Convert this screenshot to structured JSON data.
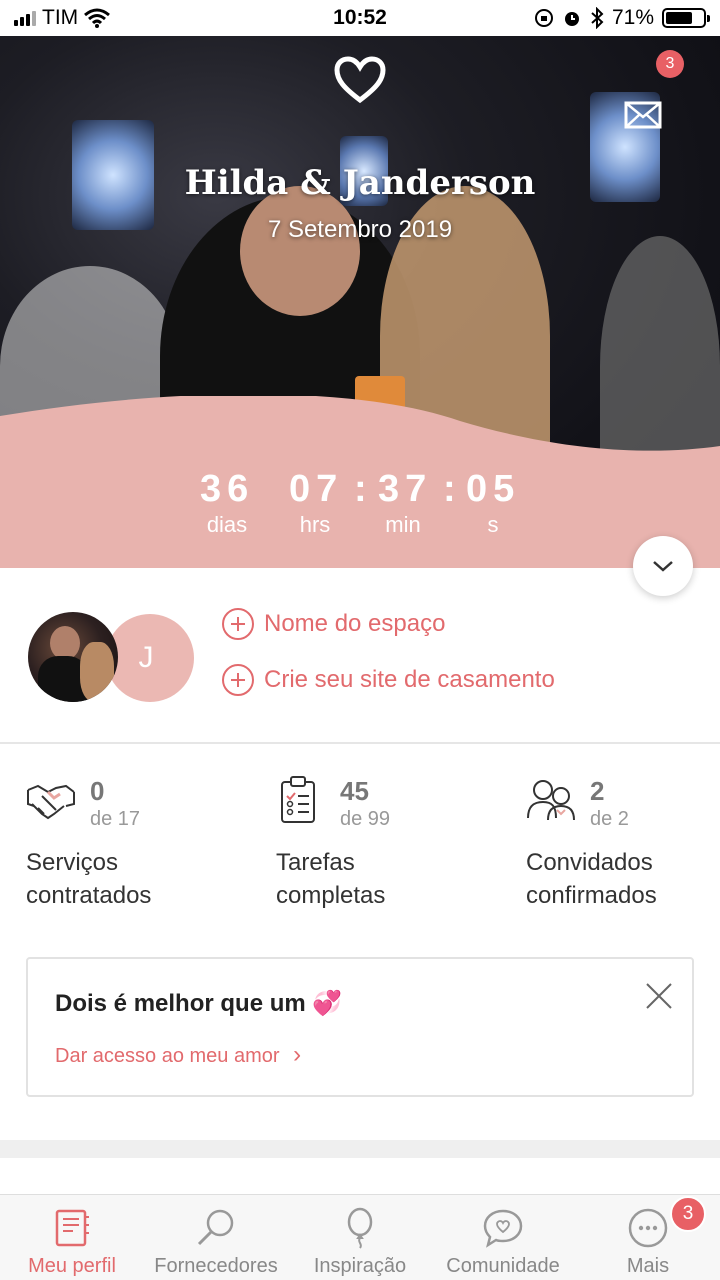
{
  "status_bar": {
    "carrier": "TIM",
    "time": "10:52",
    "battery_percent": "71%",
    "battery_level": 0.71,
    "icons": [
      "signal-icon",
      "wifi-icon",
      "rotation-lock-icon",
      "alarm-icon",
      "bluetooth-icon",
      "battery-icon"
    ]
  },
  "header": {
    "logo_icon": "heart-logo-icon",
    "mail_icon": "mail-icon",
    "mail_badge": "3",
    "couple_name": "Hilda & Janderson",
    "wedding_date": "7 Setembro 2019"
  },
  "countdown": {
    "days": "36",
    "hours": "07",
    "minutes": "37",
    "seconds": "05",
    "days_label": "dias",
    "hours_label": "hrs",
    "minutes_label": "min",
    "seconds_label": "s",
    "separator": ":"
  },
  "profile": {
    "partner_initial": "J",
    "actions": [
      {
        "label": "Nome do espaço"
      },
      {
        "label": "Crie seu site de casamento"
      }
    ]
  },
  "stats": [
    {
      "icon": "handshake-icon",
      "count": "0",
      "total": "de 17",
      "label_line1": "Serviços",
      "label_line2": "contratados"
    },
    {
      "icon": "clipboard-icon",
      "count": "45",
      "total": "de 99",
      "label_line1": "Tarefas",
      "label_line2": "completas"
    },
    {
      "icon": "guests-icon",
      "count": "2",
      "total": "de 2",
      "label_line1": "Convidados",
      "label_line2": "confirmados"
    }
  ],
  "invite_card": {
    "title": "Dois é melhor que um",
    "emoji": "💞",
    "link": "Dar acesso ao meu amor",
    "chevron": "›"
  },
  "bottom_nav": {
    "items": [
      {
        "label": "Meu perfil",
        "icon": "notebook-icon",
        "active": true
      },
      {
        "label": "Fornecedores",
        "icon": "magnifier-icon",
        "active": false
      },
      {
        "label": "Inspiração",
        "icon": "balloon-icon",
        "active": false
      },
      {
        "label": "Comunidade",
        "icon": "chat-heart-icon",
        "active": false
      },
      {
        "label": "Mais",
        "icon": "more-icon",
        "active": false
      }
    ],
    "more_badge": "3"
  },
  "colors": {
    "accent": "#e26a6d",
    "countdown_band": "#e8b3ae",
    "badge": "#e86065"
  }
}
